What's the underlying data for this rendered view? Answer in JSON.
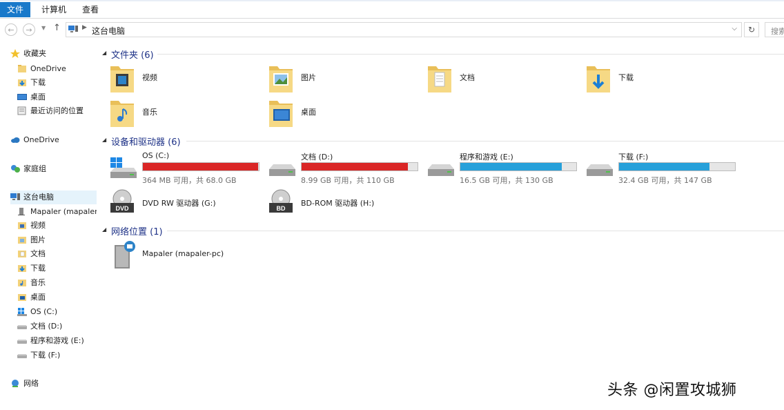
{
  "ribbon": {
    "tabs": [
      "文件",
      "计算机",
      "查看"
    ]
  },
  "address": {
    "crumb": "这台电脑",
    "search_placeholder": "搜索"
  },
  "sidebar": {
    "favorites": {
      "label": "收藏夹",
      "items": [
        "OneDrive",
        "下载",
        "桌面",
        "最近访问的位置"
      ]
    },
    "onedrive": "OneDrive",
    "homegroup": "家庭组",
    "thispc": {
      "label": "这台电脑",
      "items": [
        "Mapaler (mapaler",
        "视频",
        "图片",
        "文档",
        "下载",
        "音乐",
        "桌面",
        "OS (C:)",
        "文档 (D:)",
        "程序和游戏 (E:)",
        "下载 (F:)"
      ]
    },
    "network": "网络"
  },
  "groups": {
    "folders": {
      "title": "文件夹 (6)",
      "items": [
        "视频",
        "图片",
        "文档",
        "下载",
        "音乐",
        "桌面"
      ]
    },
    "devices": {
      "title": "设备和驱动器 (6)"
    },
    "network": {
      "title": "网络位置 (1)",
      "items": [
        "Mapaler (mapaler-pc)"
      ]
    }
  },
  "drives": [
    {
      "name": "OS (C:)",
      "free": "364 MB 可用，共 68.0 GB",
      "used_fraction": 0.995,
      "color": "#da2626"
    },
    {
      "name": "文档 (D:)",
      "free": "8.99 GB 可用，共 110 GB",
      "used_fraction": 0.918,
      "color": "#da2626"
    },
    {
      "name": "程序和游戏 (E:)",
      "free": "16.5 GB 可用，共 130 GB",
      "used_fraction": 0.873,
      "color": "#26a0da"
    },
    {
      "name": "下载 (F:)",
      "free": "32.4 GB 可用，共 147 GB",
      "used_fraction": 0.78,
      "color": "#26a0da"
    }
  ],
  "optical": [
    "DVD RW 驱动器 (G:)",
    "BD-ROM 驱动器 (H:)"
  ],
  "optical_badges": [
    "DVD",
    "BD"
  ],
  "watermark": "头条 @闲置攻城狮",
  "colors": {
    "accent": "#1979ca",
    "critical": "#da2626",
    "normal": "#26a0da"
  }
}
